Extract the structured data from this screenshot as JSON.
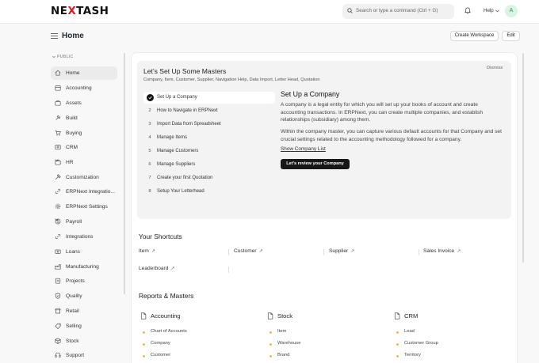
{
  "app": {
    "logo_prefix": "NE",
    "logo_x": "X",
    "logo_suffix": "TASH"
  },
  "navbar": {
    "search_placeholder": "Search or type a command (Ctrl + G)",
    "help_label": "Help",
    "avatar_initial": "A"
  },
  "page": {
    "title": "Home",
    "create_workspace": "Create Workspace",
    "edit": "Edit"
  },
  "sidebar": {
    "section": "PUBLIC",
    "items": [
      {
        "label": "Home",
        "icon": "home-icon"
      },
      {
        "label": "Accounting",
        "icon": "accounting-icon"
      },
      {
        "label": "Assets",
        "icon": "assets-icon"
      },
      {
        "label": "Build",
        "icon": "build-icon"
      },
      {
        "label": "Buying",
        "icon": "buying-icon"
      },
      {
        "label": "CRM",
        "icon": "crm-icon"
      },
      {
        "label": "HR",
        "icon": "hr-icon"
      },
      {
        "label": "Customization",
        "icon": "customization-icon"
      },
      {
        "label": "ERPNext Integratio...",
        "icon": "integration-icon"
      },
      {
        "label": "ERPNext Settings",
        "icon": "settings-icon"
      },
      {
        "label": "Payroll",
        "icon": "payroll-icon"
      },
      {
        "label": "Integrations",
        "icon": "integrations-icon"
      },
      {
        "label": "Loans",
        "icon": "loans-icon"
      },
      {
        "label": "Manufacturing",
        "icon": "manufacturing-icon"
      },
      {
        "label": "Projects",
        "icon": "projects-icon"
      },
      {
        "label": "Quality",
        "icon": "quality-icon"
      },
      {
        "label": "Retail",
        "icon": "retail-icon"
      },
      {
        "label": "Selling",
        "icon": "selling-icon"
      },
      {
        "label": "Stock",
        "icon": "stock-icon"
      },
      {
        "label": "Support",
        "icon": "support-icon"
      }
    ]
  },
  "onboarding": {
    "title": "Let's Set Up Some Masters",
    "subtitle": "Company, Item, Customer, Supplier, Navigation Help, Data Import, Letter Head, Quotation",
    "dismiss": "Dismiss",
    "steps": [
      {
        "num": "",
        "label": "Set Up a Company"
      },
      {
        "num": "2",
        "label": "How to Navigate in ERPNext"
      },
      {
        "num": "3",
        "label": "Import Data from Spreadsheet"
      },
      {
        "num": "4",
        "label": "Manage Items"
      },
      {
        "num": "5",
        "label": "Manage Customers"
      },
      {
        "num": "6",
        "label": "Manage Suppliers"
      },
      {
        "num": "7",
        "label": "Create your first Quotation"
      },
      {
        "num": "8",
        "label": "Setup Your Letterhead"
      }
    ],
    "detail": {
      "title": "Set Up a Company",
      "p1": "A company is a legal entity for which you will set up your books of account and create accounting transactions. In ERPNext, you can create multiple companies, and establish relationships (subsidiary) among them.",
      "p2": "Within the company master, you can capture various default accounts for that Company and set crucial settings related to the accounting methodology followed for a company.",
      "link": "Show Company List",
      "button": "Let's review your Company"
    }
  },
  "shortcuts": {
    "title": "Your Shortcuts",
    "items": [
      "Item",
      "Customer",
      "Supplier",
      "Sales Invoice",
      "Leaderboard"
    ]
  },
  "reports": {
    "title": "Reports & Masters",
    "columns": [
      {
        "title": "Accounting",
        "items": [
          "Chart of Accounts",
          "Company",
          "Customer"
        ]
      },
      {
        "title": "Stock",
        "items": [
          "Item",
          "Warehouse",
          "Brand"
        ]
      },
      {
        "title": "CRM",
        "items": [
          "Lead",
          "Customer Group",
          "Territory"
        ]
      }
    ]
  },
  "colors": {
    "brand_red": "#d81f26",
    "primary_button": "#171717",
    "bullet": "#f0b468"
  }
}
